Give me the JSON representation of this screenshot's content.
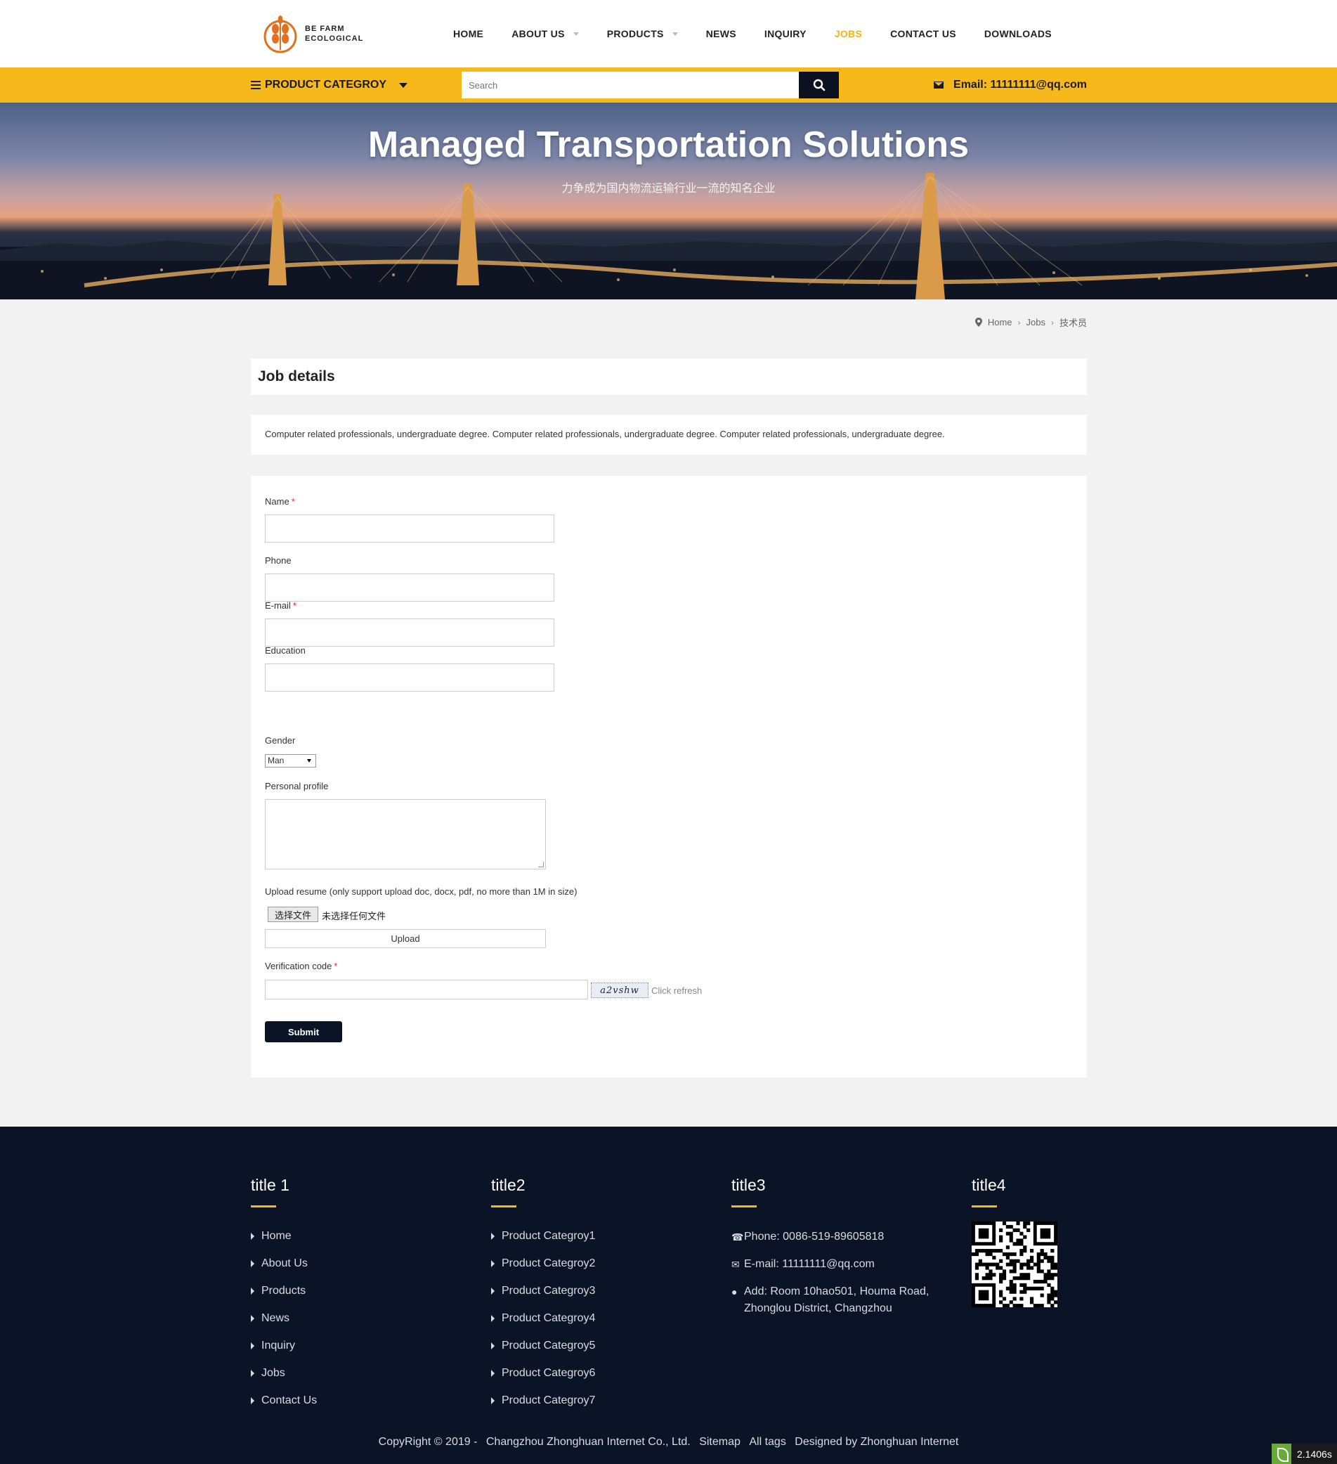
{
  "logo": {
    "line1": "BE FARM",
    "line2": "ECOLOGICAL",
    "brand_color": "#e2701f"
  },
  "nav": {
    "items": [
      {
        "label": "HOME",
        "dropdown": false,
        "active": false
      },
      {
        "label": "ABOUT US",
        "dropdown": true,
        "active": false
      },
      {
        "label": "PRODUCTS",
        "dropdown": true,
        "active": false
      },
      {
        "label": "NEWS",
        "dropdown": false,
        "active": false
      },
      {
        "label": "INQUIRY",
        "dropdown": false,
        "active": false
      },
      {
        "label": "JOBS",
        "dropdown": false,
        "active": true
      },
      {
        "label": "CONTACT US",
        "dropdown": false,
        "active": false
      },
      {
        "label": "DOWNLOADS",
        "dropdown": false,
        "active": false
      }
    ],
    "active_color": "#f0b41b"
  },
  "topbar": {
    "category_label": "PRODUCT CATEGROY",
    "search_placeholder": "Search",
    "email": "Email: 11111111@qq.com",
    "bar_color": "#f7b81b"
  },
  "banner": {
    "title": "Managed Transportation Solutions",
    "subtitle": "力争成为国内物流运输行业一流的知名企业"
  },
  "breadcrumb": {
    "home": "Home",
    "jobs": "Jobs",
    "current": "技术员"
  },
  "job": {
    "heading": "Job details",
    "description": "Computer related professionals, undergraduate degree. Computer related professionals, undergraduate degree. Computer related professionals, undergraduate degree."
  },
  "form": {
    "name_label": "Name",
    "phone_label": "Phone",
    "email_label": "E-mail",
    "education_label": "Education",
    "gender_label": "Gender",
    "gender_value": "Man",
    "profile_label": "Personal profile",
    "resume_label": "Upload resume (only support upload doc, docx, pdf, no more than 1M in size)",
    "file_button": "选择文件",
    "file_status": "未选择任何文件",
    "upload_button": "Upload",
    "verification_label": "Verification code",
    "captcha_text": "a2vshw",
    "refresh_label": "Click refresh",
    "submit_label": "Submit",
    "required_mark": "*",
    "name_value": "",
    "phone_value": "",
    "email_value": "",
    "education_value": "",
    "profile_value": "",
    "verification_value": ""
  },
  "footer": {
    "col1": {
      "title": "title 1",
      "links": [
        "Home",
        "About Us",
        "Products",
        "News",
        "Inquiry",
        "Jobs",
        "Contact Us"
      ]
    },
    "col2": {
      "title": "title2",
      "links": [
        "Product Categroy1",
        "Product Categroy2",
        "Product Categroy3",
        "Product Categroy4",
        "Product Categroy5",
        "Product Categroy6",
        "Product Categroy7"
      ]
    },
    "col3": {
      "title": "title3",
      "phone": "Phone: 0086-519-89605818",
      "email": "E-mail: 11111111@qq.com",
      "address": "Add: Room 10hao501, Houma Road, Zhonglou District, Changzhou"
    },
    "col4": {
      "title": "title4"
    },
    "copyright": "CopyRight © 2019 -",
    "company": "Changzhou Zhonghuan Internet Co., Ltd.",
    "sitemap": "Sitemap",
    "alltags": "All tags",
    "designed": "Designed by Zhonghuan Internet",
    "accent_color": "#f7b81b",
    "bg_color": "#0b1427"
  },
  "speed_badge": "2.1406s"
}
